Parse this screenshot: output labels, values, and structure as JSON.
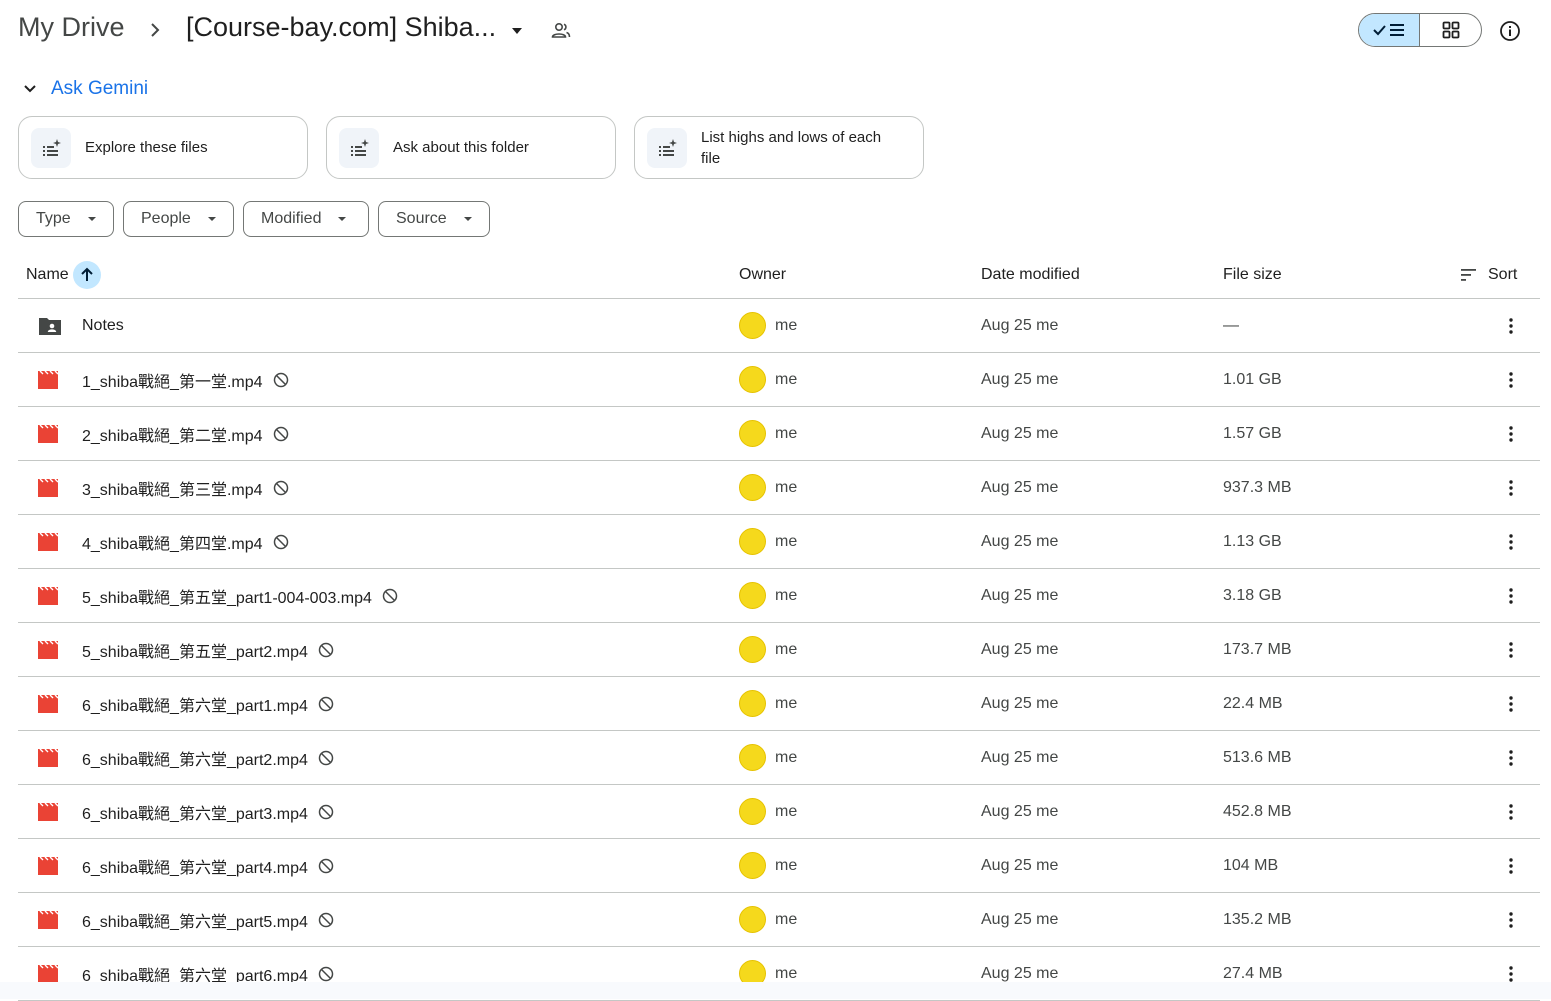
{
  "breadcrumb": {
    "root": "My Drive",
    "current": "[Course-bay.com] Shiba..."
  },
  "gemini": {
    "title": "Ask Gemini",
    "suggestions": [
      {
        "label": "Explore these files"
      },
      {
        "label": "Ask about this folder"
      },
      {
        "label": "List highs and lows of each file"
      }
    ]
  },
  "filters": [
    {
      "label": "Type"
    },
    {
      "label": "People"
    },
    {
      "label": "Modified"
    },
    {
      "label": "Source"
    }
  ],
  "table": {
    "headers": {
      "name": "Name",
      "owner": "Owner",
      "date_modified": "Date modified",
      "file_size": "File size",
      "sort": "Sort"
    },
    "rows": [
      {
        "name": "Notes",
        "type": "shared-folder",
        "owner": "me",
        "modified": "Aug 25 me",
        "size": "—"
      },
      {
        "name": "1_shiba戰絕_第一堂.mp4",
        "type": "video",
        "owner": "me",
        "modified": "Aug 25 me",
        "size": "1.01 GB"
      },
      {
        "name": "2_shiba戰絕_第二堂.mp4",
        "type": "video",
        "owner": "me",
        "modified": "Aug 25 me",
        "size": "1.57 GB"
      },
      {
        "name": "3_shiba戰絕_第三堂.mp4",
        "type": "video",
        "owner": "me",
        "modified": "Aug 25 me",
        "size": "937.3 MB"
      },
      {
        "name": "4_shiba戰絕_第四堂.mp4",
        "type": "video",
        "owner": "me",
        "modified": "Aug 25 me",
        "size": "1.13 GB"
      },
      {
        "name": "5_shiba戰絕_第五堂_part1-004-003.mp4",
        "type": "video",
        "owner": "me",
        "modified": "Aug 25 me",
        "size": "3.18 GB"
      },
      {
        "name": "5_shiba戰絕_第五堂_part2.mp4",
        "type": "video",
        "owner": "me",
        "modified": "Aug 25 me",
        "size": "173.7 MB"
      },
      {
        "name": "6_shiba戰絕_第六堂_part1.mp4",
        "type": "video",
        "owner": "me",
        "modified": "Aug 25 me",
        "size": "22.4 MB"
      },
      {
        "name": "6_shiba戰絕_第六堂_part2.mp4",
        "type": "video",
        "owner": "me",
        "modified": "Aug 25 me",
        "size": "513.6 MB"
      },
      {
        "name": "6_shiba戰絕_第六堂_part3.mp4",
        "type": "video",
        "owner": "me",
        "modified": "Aug 25 me",
        "size": "452.8 MB"
      },
      {
        "name": "6_shiba戰絕_第六堂_part4.mp4",
        "type": "video",
        "owner": "me",
        "modified": "Aug 25 me",
        "size": "104 MB"
      },
      {
        "name": "6_shiba戰絕_第六堂_part5.mp4",
        "type": "video",
        "owner": "me",
        "modified": "Aug 25 me",
        "size": "135.2 MB"
      },
      {
        "name": "6_shiba戰絕_第六堂_part6.mp4",
        "type": "video",
        "owner": "me",
        "modified": "Aug 25 me",
        "size": "27.4 MB"
      }
    ]
  },
  "colors": {
    "accent": "#1a73e8",
    "selected_toggle": "#c2e7ff",
    "video_icon": "#ea4335",
    "avatar": "#f5d91c"
  }
}
